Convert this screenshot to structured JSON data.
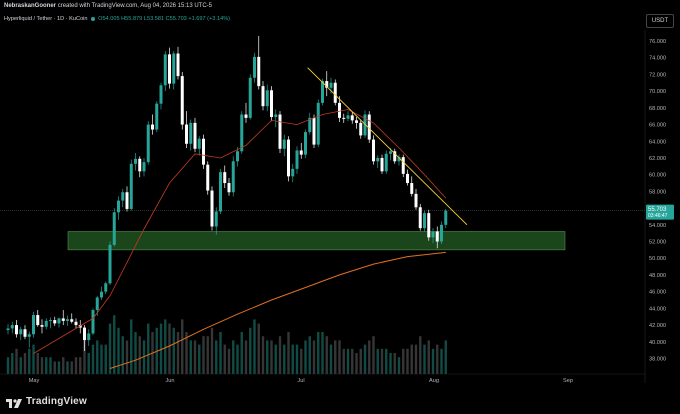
{
  "header": {
    "author": "NebraskanGooner",
    "caption": "created with TradingView.com, Aug 04, 2026 15:13 UTC-5"
  },
  "symbol": {
    "name": "Hyperliquid / Tether · 1D · KuCoin",
    "open": "O54.005",
    "high": "H55.879",
    "low": "L53.581",
    "close": "C55.703",
    "change": "+1.697 (+3.14%)"
  },
  "currency_button": "USDT",
  "price_tag": {
    "price": "55.703",
    "countdown": "03:46:47"
  },
  "brand": "TradingView",
  "colors": {
    "background": "#000000",
    "up": "#26a69a",
    "down": "#ffffff",
    "zone": "#1e4d1e",
    "trendline": "#f2d23c",
    "ma_fast": "#c23b22",
    "ma_slow": "#e07020"
  },
  "chart_data": {
    "type": "candlestick",
    "y_range": [
      36,
      78
    ],
    "y_ticks": [
      "76.000",
      "74.000",
      "72.000",
      "70.000",
      "68.000",
      "66.000",
      "64.000",
      "62.000",
      "60.000",
      "58.000",
      "56.000",
      "54.000",
      "52.000",
      "50.000",
      "48.000",
      "46.000",
      "44.000",
      "42.000",
      "40.000",
      "38.000"
    ],
    "x_labels": [
      "May",
      "Jun",
      "Jul",
      "Aug",
      "Sep"
    ],
    "support_zone": [
      51.0,
      53.2
    ],
    "trendline": {
      "from": [
        "Jul 01",
        72.8
      ],
      "to": [
        "Aug 06",
        54.0
      ]
    },
    "candles": [
      [
        41.4,
        42.1,
        40.9,
        41.6,
        4
      ],
      [
        41.6,
        42.4,
        41.0,
        42.0,
        5
      ],
      [
        42.0,
        42.6,
        40.5,
        40.9,
        6
      ],
      [
        40.9,
        41.8,
        40.2,
        41.5,
        4
      ],
      [
        41.5,
        42.0,
        40.3,
        40.6,
        5
      ],
      [
        40.6,
        41.2,
        39.3,
        40.9,
        6
      ],
      [
        40.9,
        43.6,
        40.5,
        43.2,
        7
      ],
      [
        43.2,
        43.8,
        41.8,
        42.0,
        5
      ],
      [
        42.0,
        42.7,
        41.0,
        41.8,
        4
      ],
      [
        41.8,
        42.8,
        41.5,
        42.5,
        4
      ],
      [
        42.5,
        42.9,
        41.6,
        42.6,
        4
      ],
      [
        42.6,
        43.0,
        41.9,
        42.2,
        3
      ],
      [
        42.2,
        42.9,
        41.7,
        42.8,
        3
      ],
      [
        42.8,
        43.8,
        42.0,
        42.5,
        4
      ],
      [
        42.5,
        43.1,
        41.9,
        42.7,
        3
      ],
      [
        42.7,
        43.4,
        42.2,
        42.4,
        3
      ],
      [
        42.4,
        42.8,
        41.6,
        42.0,
        4
      ],
      [
        42.0,
        42.6,
        41.0,
        41.7,
        4
      ],
      [
        41.7,
        42.0,
        38.9,
        40.2,
        8
      ],
      [
        40.2,
        41.5,
        39.5,
        41.0,
        5
      ],
      [
        41.0,
        44.0,
        40.8,
        43.8,
        7
      ],
      [
        43.8,
        45.5,
        43.1,
        45.3,
        8
      ],
      [
        45.3,
        46.6,
        45.0,
        46.0,
        7
      ],
      [
        46.0,
        47.2,
        45.7,
        47.0,
        7
      ],
      [
        47.0,
        52.0,
        46.8,
        51.6,
        12
      ],
      [
        51.6,
        56.0,
        51.4,
        55.5,
        14
      ],
      [
        55.5,
        57.4,
        54.6,
        56.9,
        11
      ],
      [
        56.9,
        58.3,
        56.1,
        57.9,
        9
      ],
      [
        57.9,
        58.6,
        55.6,
        55.9,
        8
      ],
      [
        55.9,
        61.8,
        55.7,
        61.3,
        13
      ],
      [
        61.3,
        62.6,
        60.5,
        61.9,
        10
      ],
      [
        61.9,
        62.2,
        59.7,
        60.4,
        9
      ],
      [
        60.4,
        62.0,
        59.8,
        61.5,
        8
      ],
      [
        61.5,
        66.4,
        61.2,
        66.0,
        12
      ],
      [
        66.0,
        67.2,
        64.8,
        65.4,
        10
      ],
      [
        65.4,
        68.8,
        65.1,
        68.5,
        11
      ],
      [
        68.5,
        71.0,
        67.8,
        70.7,
        12
      ],
      [
        70.7,
        74.8,
        70.0,
        74.4,
        13
      ],
      [
        74.4,
        75.2,
        70.3,
        70.9,
        12
      ],
      [
        70.9,
        74.8,
        70.2,
        74.5,
        11
      ],
      [
        74.5,
        75.3,
        71.4,
        71.8,
        10
      ],
      [
        71.8,
        72.3,
        65.4,
        66.0,
        13
      ],
      [
        66.0,
        67.6,
        63.2,
        63.7,
        10
      ],
      [
        63.7,
        66.6,
        62.9,
        66.2,
        8
      ],
      [
        66.2,
        66.8,
        62.7,
        63.1,
        8
      ],
      [
        63.1,
        64.6,
        62.3,
        64.3,
        7
      ],
      [
        64.3,
        64.8,
        60.7,
        61.2,
        9
      ],
      [
        61.2,
        61.6,
        57.6,
        58.1,
        9
      ],
      [
        58.1,
        58.6,
        53.3,
        53.8,
        11
      ],
      [
        53.8,
        56.1,
        52.8,
        55.6,
        8
      ],
      [
        55.6,
        60.7,
        55.3,
        60.3,
        10
      ],
      [
        60.3,
        61.1,
        58.4,
        59.0,
        7
      ],
      [
        59.0,
        59.6,
        57.5,
        57.9,
        6
      ],
      [
        57.9,
        62.2,
        57.4,
        61.6,
        8
      ],
      [
        61.6,
        63.3,
        61.0,
        62.8,
        7
      ],
      [
        62.8,
        67.6,
        62.5,
        67.2,
        10
      ],
      [
        67.2,
        68.6,
        66.2,
        66.8,
        8
      ],
      [
        66.8,
        72.0,
        66.6,
        71.6,
        11
      ],
      [
        71.6,
        74.6,
        71.0,
        74.1,
        13
      ],
      [
        74.1,
        76.6,
        70.2,
        70.6,
        12
      ],
      [
        70.6,
        71.2,
        67.7,
        68.2,
        9
      ],
      [
        68.2,
        70.8,
        67.6,
        70.1,
        8
      ],
      [
        70.1,
        70.6,
        66.4,
        66.9,
        8
      ],
      [
        66.9,
        67.8,
        65.7,
        67.2,
        7
      ],
      [
        67.2,
        67.6,
        62.6,
        63.1,
        9
      ],
      [
        63.1,
        64.8,
        62.2,
        64.2,
        7
      ],
      [
        64.2,
        64.6,
        59.2,
        59.8,
        10
      ],
      [
        59.8,
        61.3,
        59.1,
        60.7,
        7
      ],
      [
        60.7,
        63.4,
        60.1,
        62.9,
        7
      ],
      [
        62.9,
        63.8,
        61.9,
        62.4,
        6
      ],
      [
        62.4,
        65.4,
        62.0,
        65.1,
        8
      ],
      [
        65.1,
        67.4,
        64.8,
        66.8,
        9
      ],
      [
        66.8,
        67.2,
        63.2,
        63.6,
        8
      ],
      [
        63.6,
        69.0,
        63.3,
        68.6,
        10
      ],
      [
        68.6,
        71.5,
        68.3,
        71.2,
        10
      ],
      [
        71.2,
        72.4,
        69.4,
        70.4,
        9
      ],
      [
        70.4,
        71.6,
        69.7,
        71.0,
        7
      ],
      [
        71.0,
        71.4,
        68.3,
        68.6,
        8
      ],
      [
        68.6,
        69.4,
        66.3,
        66.8,
        8
      ],
      [
        66.8,
        67.3,
        66.2,
        66.7,
        6
      ],
      [
        66.7,
        67.6,
        66.4,
        67.1,
        6
      ],
      [
        67.1,
        67.5,
        66.1,
        66.5,
        6
      ],
      [
        66.5,
        66.9,
        65.5,
        66.2,
        5
      ],
      [
        66.2,
        66.6,
        64.3,
        64.7,
        6
      ],
      [
        64.7,
        67.7,
        64.4,
        67.2,
        7
      ],
      [
        67.2,
        67.6,
        63.8,
        64.2,
        8
      ],
      [
        64.2,
        64.7,
        61.2,
        61.6,
        9
      ],
      [
        61.6,
        62.3,
        60.8,
        62.0,
        6
      ],
      [
        62.0,
        62.4,
        60.1,
        60.4,
        6
      ],
      [
        60.4,
        62.9,
        60.1,
        62.5,
        6
      ],
      [
        62.5,
        63.2,
        61.7,
        62.8,
        5
      ],
      [
        62.8,
        63.1,
        61.3,
        61.6,
        5
      ],
      [
        61.6,
        62.4,
        61.1,
        62.1,
        4
      ],
      [
        62.1,
        62.4,
        59.7,
        60.1,
        6
      ],
      [
        60.1,
        60.6,
        58.7,
        59.0,
        6
      ],
      [
        59.0,
        59.8,
        57.4,
        57.7,
        7
      ],
      [
        57.7,
        58.3,
        55.8,
        56.1,
        7
      ],
      [
        56.1,
        56.5,
        53.3,
        53.6,
        9
      ],
      [
        53.6,
        55.7,
        53.2,
        55.4,
        7
      ],
      [
        55.4,
        55.8,
        52.1,
        52.5,
        8
      ],
      [
        52.5,
        53.6,
        51.8,
        53.2,
        6
      ],
      [
        53.2,
        53.8,
        51.2,
        52.0,
        7
      ],
      [
        52.0,
        54.4,
        51.7,
        54.0,
        6
      ],
      [
        54.0,
        55.9,
        53.6,
        55.7,
        8
      ]
    ],
    "ma_fast": [
      [
        6,
        38.6
      ],
      [
        14,
        41.0
      ],
      [
        20,
        42.8
      ],
      [
        24,
        45.5
      ],
      [
        28,
        49.5
      ],
      [
        32,
        53.5
      ],
      [
        38,
        59.0
      ],
      [
        44,
        62.5
      ],
      [
        50,
        62.0
      ],
      [
        56,
        63.5
      ],
      [
        62,
        66.5
      ],
      [
        68,
        66.0
      ],
      [
        74,
        67.2
      ],
      [
        80,
        67.8
      ],
      [
        86,
        66.2
      ],
      [
        92,
        63.2
      ],
      [
        98,
        60.0
      ],
      [
        103,
        57.2
      ]
    ],
    "ma_slow": [
      [
        24,
        36.8
      ],
      [
        30,
        37.8
      ],
      [
        38,
        39.5
      ],
      [
        46,
        41.5
      ],
      [
        54,
        43.3
      ],
      [
        62,
        45.0
      ],
      [
        70,
        46.5
      ],
      [
        78,
        48.0
      ],
      [
        86,
        49.3
      ],
      [
        94,
        50.2
      ],
      [
        103,
        50.7
      ]
    ]
  }
}
